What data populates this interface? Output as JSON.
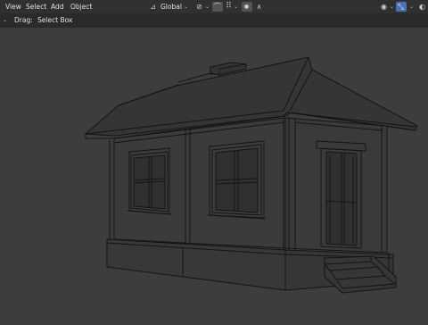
{
  "menu": {
    "view": "View",
    "select": "Select",
    "add": "Add",
    "object": "Object"
  },
  "header_tools": {
    "transform_orientation": "Global"
  },
  "toolbar": {
    "drag_label": "Drag:",
    "drag_value": "Select Box"
  },
  "colors": {
    "header_bg": "#303030",
    "viewport_bg": "#3d3d3d",
    "wire": "#141414",
    "active_blue": "#4772b3"
  },
  "icons": {
    "orientation": "transform-orientation-icon",
    "pivot": "pivot-point-icon",
    "snap": "snap-magnet-icon",
    "proportional": "proportional-editing-icon",
    "falloff": "falloff-curve-icon",
    "visibility": "visibility-icon",
    "gizmo": "gizmo-icon"
  }
}
